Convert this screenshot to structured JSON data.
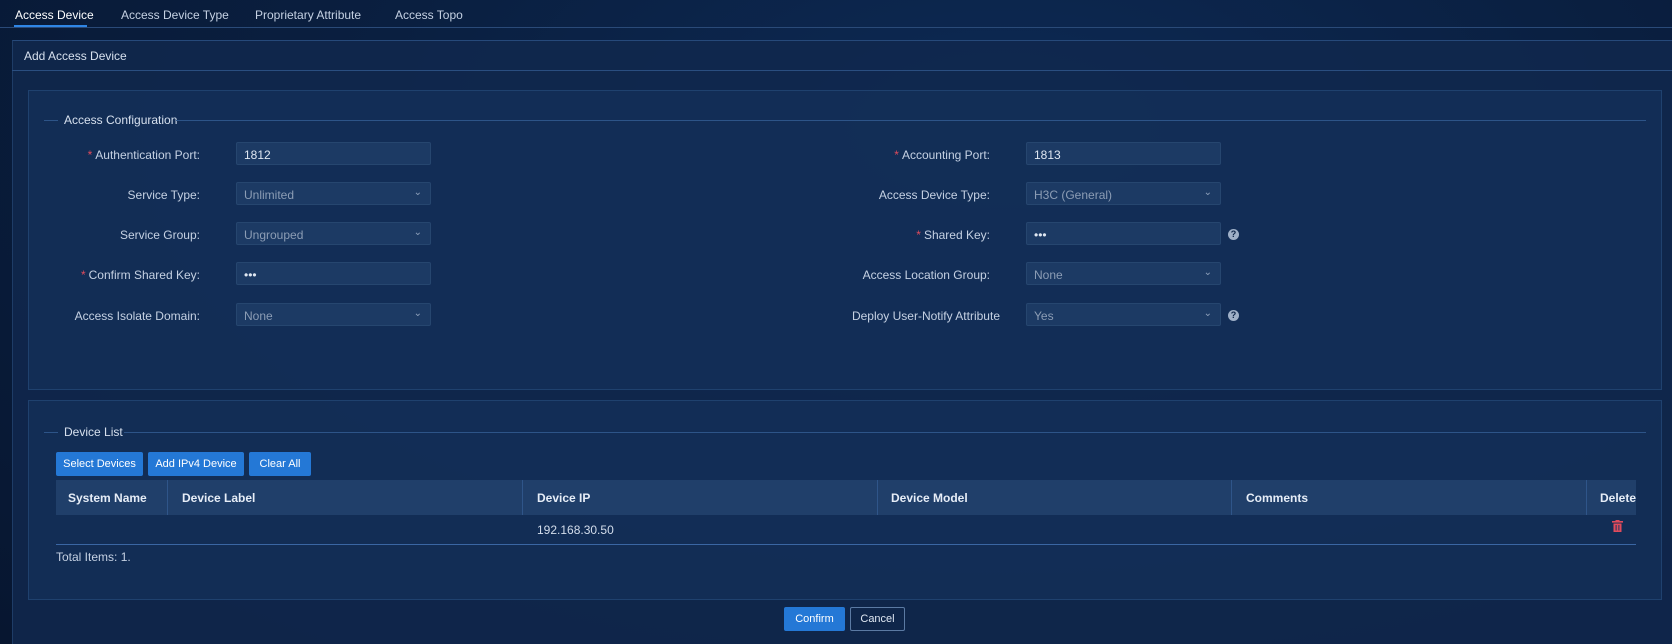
{
  "tabs": [
    "Access Device",
    "Access Device Type",
    "Proprietary Attribute",
    "Access Topo"
  ],
  "panel": {
    "title": "Add Access Device"
  },
  "access_config": {
    "legend": "Access Configuration",
    "auth_port": {
      "label": "Authentication Port:",
      "value": "1812"
    },
    "acct_port": {
      "label": "Accounting Port:",
      "value": "1813"
    },
    "service_type": {
      "label": "Service Type:",
      "value": "Unlimited"
    },
    "device_type": {
      "label": "Access Device Type:",
      "value": "H3C (General)"
    },
    "service_group": {
      "label": "Service Group:",
      "value": "Ungrouped"
    },
    "shared_key": {
      "label": "Shared Key:",
      "value": "•••"
    },
    "confirm_key": {
      "label": "Confirm Shared Key:",
      "value": "•••"
    },
    "location_group": {
      "label": "Access Location Group:",
      "value": "None"
    },
    "isolate_domain": {
      "label": "Access Isolate Domain:",
      "value": "None"
    },
    "notify_attr": {
      "label": "Deploy User-Notify Attribute",
      "value": "Yes"
    }
  },
  "device_list": {
    "legend": "Device List",
    "buttons": {
      "select": "Select Devices",
      "add_ipv4": "Add IPv4 Device",
      "clear": "Clear All"
    },
    "columns": [
      "System Name",
      "Device Label",
      "Device IP",
      "Device Model",
      "Comments",
      "Delete"
    ],
    "rows": [
      {
        "system_name": "",
        "device_label": "",
        "device_ip": "192.168.30.50",
        "device_model": "",
        "comments": ""
      }
    ],
    "total": "Total Items: 1."
  },
  "footer": {
    "confirm": "Confirm",
    "cancel": "Cancel"
  },
  "colors": {
    "accent": "#2478d6",
    "required": "#e04b5c",
    "delete": "#e04b5c"
  }
}
